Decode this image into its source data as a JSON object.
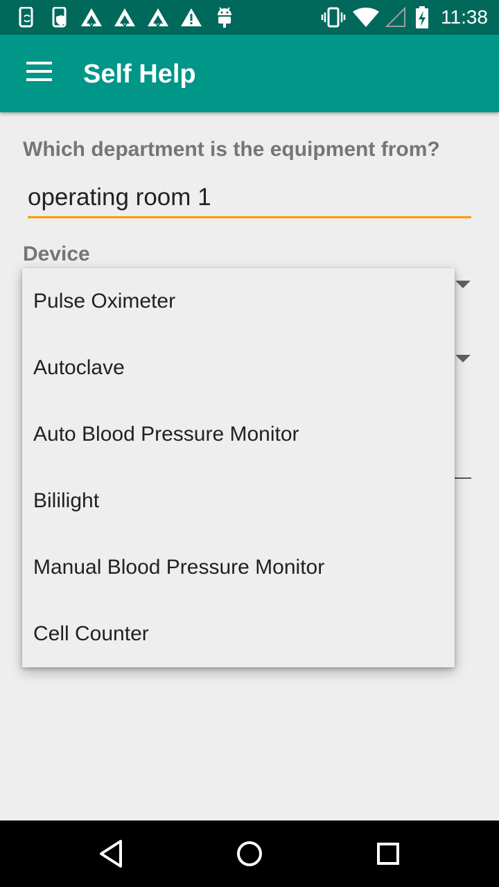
{
  "status_bar": {
    "time": "11:38",
    "left_icons": [
      "phone-sync-icon",
      "phone-shield-icon",
      "app-triangle-icon",
      "app-triangle-icon",
      "app-triangle-icon",
      "warning-icon",
      "android-icon"
    ],
    "right_icons": [
      "vibrate-icon",
      "wifi-icon",
      "cell-signal-icon",
      "battery-charging-icon"
    ]
  },
  "app_bar": {
    "title": "Self Help",
    "menu_icon": "hamburger-menu-icon",
    "color": "#009688"
  },
  "form": {
    "department_label": "Which department is the equipment from?",
    "department_value": "operating room 1",
    "device_label": "Device",
    "accent_color": "#ff9800"
  },
  "device_dropdown": {
    "options": [
      "Pulse Oximeter",
      "Autoclave",
      "Auto Blood Pressure Monitor",
      "Bililight",
      "Manual Blood Pressure Monitor",
      "Cell Counter"
    ]
  },
  "nav_bar": {
    "buttons": [
      "back-icon",
      "home-icon",
      "recents-icon"
    ]
  }
}
